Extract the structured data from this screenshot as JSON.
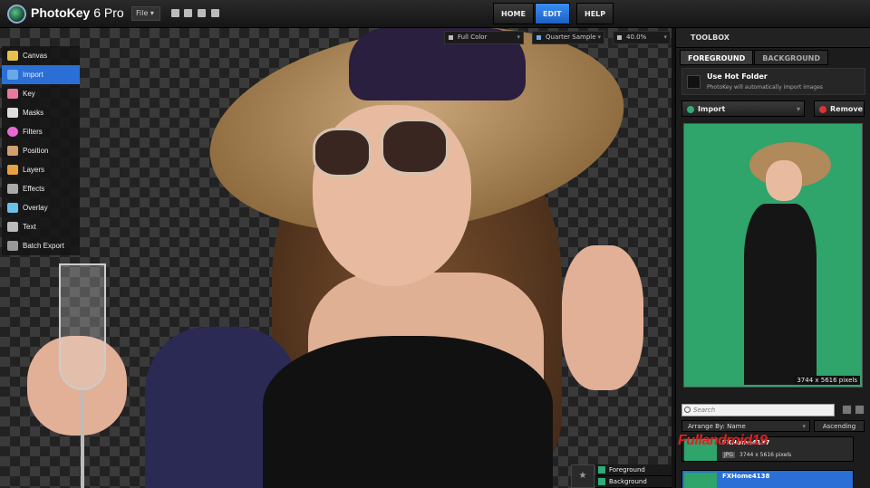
{
  "header": {
    "app_name_bold": "PhotoKey",
    "app_name_rest": " 6 Pro",
    "file_menu": "File ▾",
    "nav": [
      {
        "label": "HOME",
        "active": false
      },
      {
        "label": "EDIT",
        "active": true
      },
      {
        "label": "HELP",
        "active": false
      }
    ]
  },
  "tools": [
    {
      "label": "Canvas",
      "icon": "canvas-icon",
      "color": "#e8c04a",
      "active": false
    },
    {
      "label": "Import",
      "icon": "import-icon",
      "color": "#6aa8e8",
      "active": true
    },
    {
      "label": "Key",
      "icon": "key-icon",
      "color": "#e87aa0",
      "active": false
    },
    {
      "label": "Masks",
      "icon": "masks-icon",
      "color": "#dddddd",
      "active": false
    },
    {
      "label": "Filters",
      "icon": "filters-icon",
      "color": "#e86ad0",
      "active": false
    },
    {
      "label": "Position",
      "icon": "position-icon",
      "color": "#d0a070",
      "active": false
    },
    {
      "label": "Layers",
      "icon": "layers-icon",
      "color": "#e8a040",
      "active": false
    },
    {
      "label": "Effects",
      "icon": "effects-icon",
      "color": "#aaaaaa",
      "active": false
    },
    {
      "label": "Overlay",
      "icon": "overlay-icon",
      "color": "#6ac0e8",
      "active": false
    },
    {
      "label": "Text",
      "icon": "text-icon",
      "color": "#bbbbbb",
      "active": false
    },
    {
      "label": "Batch Export",
      "icon": "batch-export-icon",
      "color": "#999999",
      "active": false
    }
  ],
  "canvas_toolbar": {
    "color_mode": "Full Color",
    "sample": "Quarter Sample",
    "zoom": "40.0%"
  },
  "layers": [
    {
      "label": "Foreground"
    },
    {
      "label": "Background"
    }
  ],
  "toolbox": {
    "title": "TOOLBOX",
    "tabs": [
      {
        "label": "FOREGROUND",
        "active": true
      },
      {
        "label": "BACKGROUND",
        "active": false
      }
    ],
    "hot_folder_title": "Use Hot Folder",
    "hot_folder_desc": "PhotoKey will automatically import images",
    "import_label": "Import",
    "remove_label": "Remove",
    "preview_dims": "3744 x 5616 pixels",
    "search_placeholder": "Search",
    "arrange_label": "Arrange By: Name",
    "sort_label": "Ascending",
    "files": [
      {
        "name": "FXHome4137",
        "type": "JPG",
        "dims": "3744 x 5616 pixels",
        "selected": false
      },
      {
        "name": "FXHome4138",
        "type": "",
        "dims": "",
        "selected": true
      }
    ]
  },
  "watermark": "Fullandroid19"
}
